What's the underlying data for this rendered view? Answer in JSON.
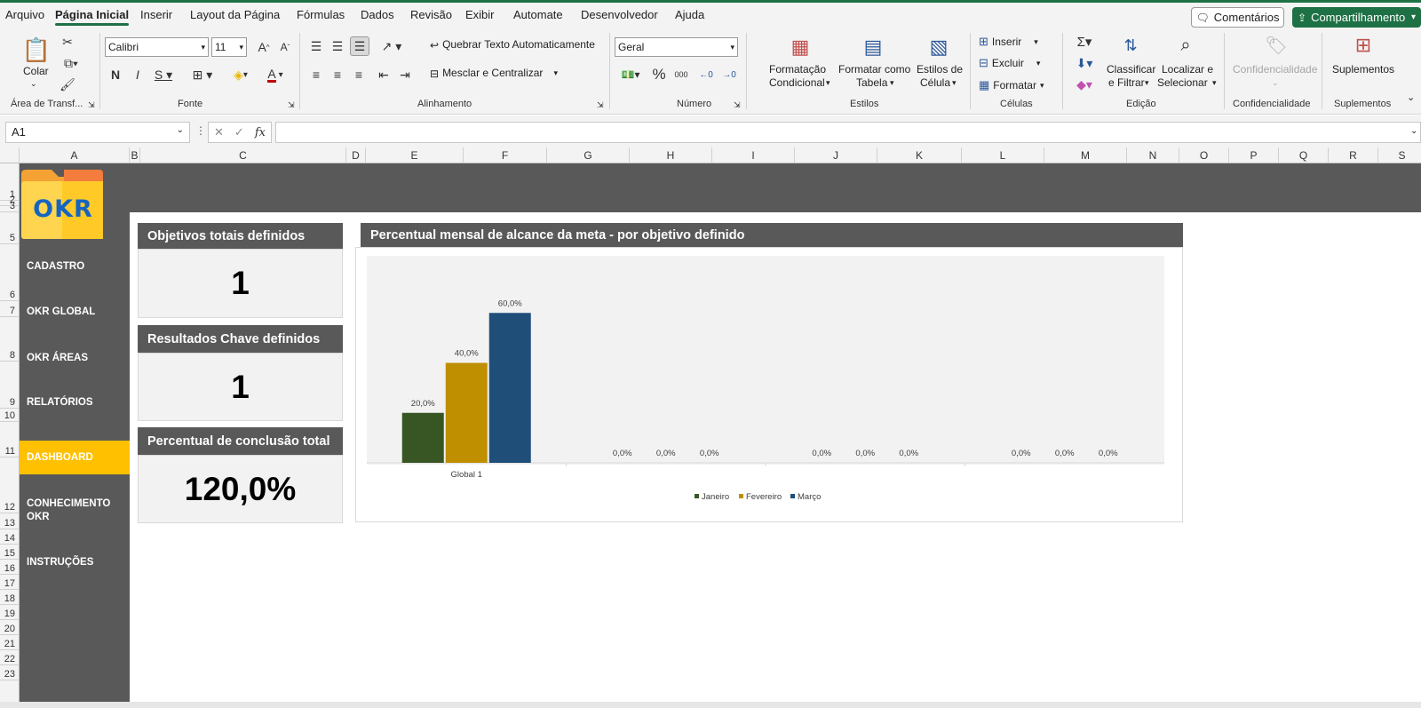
{
  "menu": {
    "tabs": [
      "Arquivo",
      "Página Inicial",
      "Inserir",
      "Layout da Página",
      "Fórmulas",
      "Dados",
      "Revisão",
      "Exibir",
      "Automate",
      "Desenvolvedor",
      "Ajuda"
    ],
    "active": "Página Inicial",
    "comments_label": "Comentários",
    "share_label": "Compartilhamento"
  },
  "ribbon": {
    "clipboard": {
      "paste_label": "Colar",
      "group": "Área de Transf..."
    },
    "font": {
      "name": "Calibri",
      "size": "11",
      "group": "Fonte"
    },
    "alignment": {
      "wrap_label": "Quebrar Texto Automaticamente",
      "merge_label": "Mesclar e Centralizar",
      "group": "Alinhamento"
    },
    "number": {
      "format": "Geral",
      "group": "Número"
    },
    "styles": {
      "conditional_line1": "Formatação",
      "conditional_line2": "Condicional",
      "table_line1": "Formatar como",
      "table_line2": "Tabela",
      "cell_line1": "Estilos de",
      "cell_line2": "Célula",
      "group": "Estilos"
    },
    "cells": {
      "insert_label": "Inserir",
      "delete_label": "Excluir",
      "format_label": "Formatar",
      "group": "Células"
    },
    "editing": {
      "sort_line1": "Classificar",
      "sort_line2": "e Filtrar",
      "find_line1": "Localizar e",
      "find_line2": "Selecionar",
      "group": "Edição"
    },
    "sensitivity": {
      "label": "Confidencialidade",
      "group": "Confidencialidade"
    },
    "addins": {
      "label": "Suplementos",
      "group": "Suplementos"
    }
  },
  "formula_bar": {
    "cell_ref": "A1",
    "fx": "fx",
    "content": ""
  },
  "columns": [
    "A",
    "B",
    "C",
    "D",
    "E",
    "F",
    "G",
    "H",
    "I",
    "J",
    "K",
    "L",
    "M",
    "N",
    "O",
    "P",
    "Q",
    "R",
    "S"
  ],
  "rows": [
    "1",
    "2",
    "3",
    "5",
    "6",
    "7",
    "8",
    "9",
    "10",
    "11",
    "12",
    "13",
    "14",
    "15",
    "16",
    "17",
    "18",
    "19",
    "20",
    "21",
    "22",
    "23"
  ],
  "logo": {
    "text": "OKR"
  },
  "sidebar": {
    "items": [
      {
        "label": "CADASTRO"
      },
      {
        "label": "OKR GLOBAL"
      },
      {
        "label": "OKR ÁREAS"
      },
      {
        "label": "RELATÓRIOS"
      },
      {
        "label": "DASHBOARD"
      },
      {
        "label": "CONHECIMENTO OKR"
      },
      {
        "label": "INSTRUÇÕES"
      }
    ],
    "active": "DASHBOARD"
  },
  "cards": [
    {
      "title": "Objetivos totais definidos",
      "value": "1"
    },
    {
      "title": "Resultados Chave definidos",
      "value": "1"
    },
    {
      "title": "Percentual de conclusão total",
      "value": "120,0%"
    }
  ],
  "chart_panel": {
    "title": "Percentual mensal de alcance da meta - por objetivo definido"
  },
  "chart_data": {
    "type": "bar",
    "categories": [
      "Global 1",
      "",
      "",
      ""
    ],
    "series": [
      {
        "name": "Janeiro",
        "values": [
          20,
          0,
          0,
          0
        ]
      },
      {
        "name": "Fevereiro",
        "values": [
          40,
          0,
          0,
          0
        ]
      },
      {
        "name": "Março",
        "values": [
          60,
          0,
          0,
          0
        ]
      }
    ],
    "data_labels": [
      [
        "20,0%",
        "40,0%",
        "60,0%"
      ],
      [
        "0,0%",
        "0,0%",
        "0,0%"
      ],
      [
        "0,0%",
        "0,0%",
        "0,0%"
      ],
      [
        "0,0%",
        "0,0%",
        "0,0%"
      ]
    ],
    "value_unit": "%",
    "ylim": [
      0,
      80
    ],
    "colors": [
      "#375623",
      "#bf8f00",
      "#1f4e79"
    ],
    "legend_position": "bottom",
    "grid": false
  }
}
